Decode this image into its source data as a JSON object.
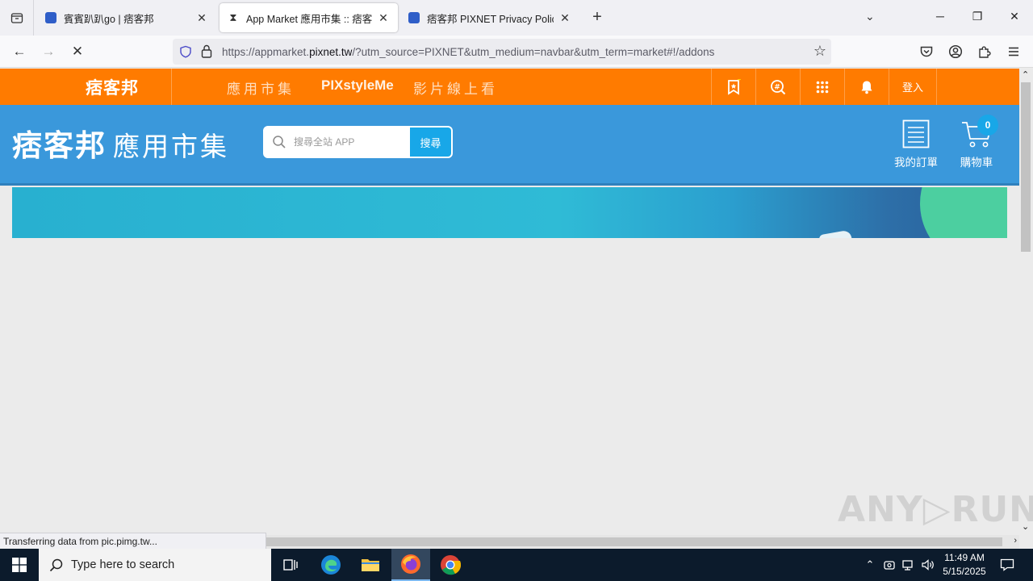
{
  "browser": {
    "tabs": [
      {
        "title": "賓賓趴趴go | 痞客邦",
        "active": false
      },
      {
        "title": "App Market 應用市集 :: 痞客邦",
        "active": true
      },
      {
        "title": "痞客邦 PIXNET Privacy Policy",
        "active": false
      }
    ],
    "new_tab": "+",
    "url_prefix": "https://appmarket.",
    "url_domain": "pixnet.tw",
    "url_suffix": "/?utm_source=PIXNET&utm_medium=navbar&utm_term=market#!/addons",
    "status_text": "Transferring data from pic.pimg.tw..."
  },
  "pixnet_nav": {
    "logo": "痞客邦",
    "links": [
      "應用市集",
      "PIXstyleMe",
      "影片線上看"
    ],
    "login": "登入"
  },
  "market_header": {
    "logo": "痞客邦",
    "logo_sub": "應用市集",
    "search_placeholder": "搜尋全站 APP",
    "search_button": "搜尋",
    "orders_label": "我的訂單",
    "cart_label": "購物車",
    "cart_count": "0"
  },
  "watermark": "ANY▷RUN",
  "taskbar": {
    "search_placeholder": "Type here to search",
    "time": "11:49 AM",
    "date": "5/15/2025"
  },
  "colors": {
    "pixnet_orange": "#ff7b00",
    "market_blue": "#3a98db",
    "accent_cyan": "#18a7e8"
  }
}
